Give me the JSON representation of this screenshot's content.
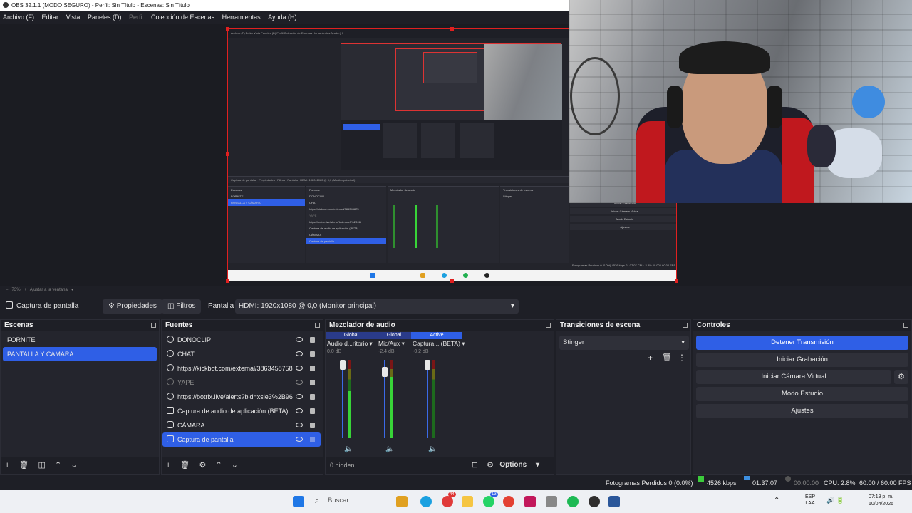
{
  "window": {
    "title": "OBS 32.1.1 (MODO SEGURO) - Perfil: Sin Título - Escenas: Sin Título"
  },
  "menu": [
    "Archivo (F)",
    "Editar",
    "Vista",
    "Paneles (D)",
    "Perfil",
    "Colección de Escenas",
    "Herramientas",
    "Ayuda (H)"
  ],
  "preview": {
    "zoom": "73%",
    "fit_label": "Ajustar a la ventana",
    "mini_menu": "Archivo (F)   Editar   Vista   Paneles (D)   Perfil   Colección de Escenas   Herramientas   Ayuda (H)",
    "mini_scenes_title": "Escenas",
    "mini_scenes": [
      "FORNITE",
      "PANTALLA Y CÁMARA"
    ],
    "mini_sources_title": "Fuentes",
    "mini_sources": [
      "DONOCLIP",
      "CHAT",
      "https://kickbot.com/external/386345875",
      "YAPE",
      "https://botrix.live/alerts?bid=xsle3%2B96",
      "Captura de audio de aplicación (BETA)",
      "CÁMARA",
      "Captura de pantalla"
    ],
    "mini_mixer_title": "Mezclador de audio",
    "mini_trans_title": "Transiciones de escena",
    "mini_trans_value": "Stinger",
    "mini_controls": [
      "Iniciar Grabación",
      "Iniciar Cámara Virtual",
      "Modo Estudio",
      "Ajustes"
    ],
    "mini_status": "Fotogramas Perdidos 0 (0.0%)   4526 kbps   01:37:07   CPU: 2.8%   60.00 / 60.00 FPS"
  },
  "context_bar": {
    "source_name": "Captura de pantalla",
    "properties_label": "Propiedades",
    "filters_label": "Filtros",
    "display_label": "Pantalla",
    "display_value": "HDMI: 1920x1080 @ 0,0 (Monitor principal)"
  },
  "scenes": {
    "title": "Escenas",
    "items": [
      "FORNITE",
      "PANTALLA Y CÁMARA"
    ],
    "selected_index": 1
  },
  "sources": {
    "title": "Fuentes",
    "items": [
      {
        "label": "DONOCLIP",
        "icon": "browser-icon",
        "visible": true
      },
      {
        "label": "CHAT",
        "icon": "browser-icon",
        "visible": true
      },
      {
        "label": "https://kickbot.com/external/3863458758",
        "icon": "browser-icon",
        "visible": true
      },
      {
        "label": "YAPE",
        "icon": "browser-icon",
        "visible": false
      },
      {
        "label": "https://botrix.live/alerts?bid=xsle3%2B96",
        "icon": "browser-icon",
        "visible": true
      },
      {
        "label": "Captura de audio de aplicación (BETA)",
        "icon": "audio-capture-icon",
        "visible": true
      },
      {
        "label": "CÁMARA",
        "icon": "camera-icon",
        "visible": true
      },
      {
        "label": "Captura de pantalla",
        "icon": "display-capture-icon",
        "visible": true
      }
    ],
    "selected_index": 7
  },
  "mixer": {
    "title": "Mezclador de audio",
    "hidden_label": "0 hidden",
    "options_label": "Options",
    "channels": [
      {
        "tag": "Global",
        "name": "Audio d...ritorio",
        "db": "0.0 dB",
        "level": 0.6,
        "fader": 0.9
      },
      {
        "tag": "Global",
        "name": "Mic/Aux",
        "db": "-2.4 dB",
        "level": 0.78,
        "fader": 0.82
      },
      {
        "tag": "Active",
        "name": "Captura... (BETA)",
        "db": "-0.2 dB",
        "level": 0.0,
        "fader": 0.88
      }
    ],
    "scale": [
      "0",
      "-6",
      "-12",
      "-18",
      "-24",
      "-30",
      "-36",
      "-42",
      "-48",
      "-54",
      "-60"
    ]
  },
  "transitions": {
    "title": "Transiciones de escena",
    "value": "Stinger"
  },
  "controls": {
    "title": "Controles",
    "stop_stream": "Detener Transmisión",
    "start_record": "Iniciar Grabación",
    "start_virtualcam": "Iniciar Cámara Virtual",
    "studio_mode": "Modo Estudio",
    "settings": "Ajustes"
  },
  "status": {
    "dropped_frames": "Fotogramas Perdidos 0 (0.0%)",
    "bitrate": "4526 kbps",
    "stream_time": "01:37:07",
    "record_time": "00:00:00",
    "cpu": "CPU: 2.8%",
    "fps": "60.00 / 60.00 FPS"
  },
  "taskbar": {
    "search_placeholder": "Buscar",
    "lang_top": "ESP",
    "lang_bottom": "LAA",
    "time": "07:19 p. m.",
    "date": "10/04/2026",
    "badge_1": "44",
    "badge_2": "13"
  },
  "colors": {
    "accent": "#2f5fe6",
    "preview_border": "#e02020",
    "panel_bg": "#24252d",
    "window_bg": "#1e1f26"
  }
}
